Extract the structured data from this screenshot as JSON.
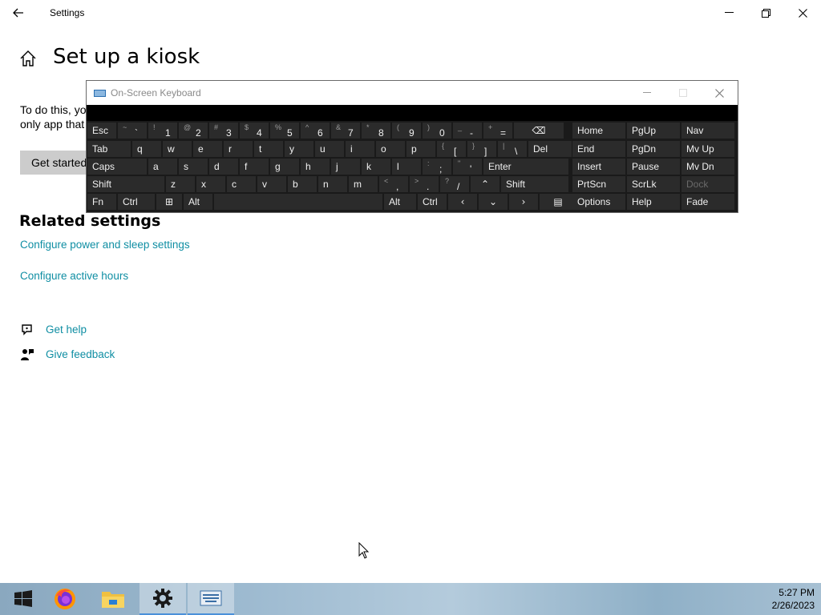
{
  "settings_window": {
    "title": "Settings",
    "back_icon": "back-arrow-icon",
    "minimize_glyph": "—",
    "restore_glyph": "❐",
    "close_glyph": "✕"
  },
  "page": {
    "title": "Set up a kiosk",
    "intro_line1": "To do this, yo",
    "intro_line2": "only app that",
    "get_started_label": "Get started"
  },
  "related": {
    "heading": "Related settings",
    "link_power": "Configure power and sleep settings",
    "link_active_hours": "Configure active hours"
  },
  "help": {
    "get_help": "Get help",
    "give_feedback": "Give feedback"
  },
  "osk": {
    "title": "On-Screen Keyboard",
    "minimize_glyph": "—",
    "maximize_glyph": "☐",
    "close_glyph": "✕",
    "rows": [
      [
        {
          "label": "Esc"
        },
        {
          "shift": "~",
          "main": "`"
        },
        {
          "shift": "!",
          "main": "1"
        },
        {
          "shift": "@",
          "main": "2"
        },
        {
          "shift": "#",
          "main": "3"
        },
        {
          "shift": "$",
          "main": "4"
        },
        {
          "shift": "%",
          "main": "5"
        },
        {
          "shift": "^",
          "main": "6"
        },
        {
          "shift": "&",
          "main": "7"
        },
        {
          "shift": "*",
          "main": "8"
        },
        {
          "shift": "(",
          "main": "9"
        },
        {
          "shift": ")",
          "main": "0"
        },
        {
          "shift": "_",
          "main": "-"
        },
        {
          "shift": "+",
          "main": "="
        },
        {
          "icon": "⌫"
        },
        {
          "label": "Home"
        },
        {
          "label": "PgUp"
        },
        {
          "label": "Nav"
        }
      ],
      [
        {
          "label": "Tab"
        },
        {
          "label": "q"
        },
        {
          "label": "w"
        },
        {
          "label": "e"
        },
        {
          "label": "r"
        },
        {
          "label": "t"
        },
        {
          "label": "y"
        },
        {
          "label": "u"
        },
        {
          "label": "i"
        },
        {
          "label": "o"
        },
        {
          "label": "p"
        },
        {
          "shift": "{",
          "main": "["
        },
        {
          "shift": "}",
          "main": "]"
        },
        {
          "shift": "|",
          "main": "\\"
        },
        {
          "label": "Del"
        },
        {
          "label": "End"
        },
        {
          "label": "PgDn"
        },
        {
          "label": "Mv Up"
        }
      ],
      [
        {
          "label": "Caps"
        },
        {
          "label": "a"
        },
        {
          "label": "s"
        },
        {
          "label": "d"
        },
        {
          "label": "f"
        },
        {
          "label": "g"
        },
        {
          "label": "h"
        },
        {
          "label": "j"
        },
        {
          "label": "k"
        },
        {
          "label": "l"
        },
        {
          "shift": ":",
          "main": ";"
        },
        {
          "shift": "\"",
          "main": "'"
        },
        {
          "label": "Enter"
        },
        {
          "label": "Insert"
        },
        {
          "label": "Pause"
        },
        {
          "label": "Mv Dn"
        }
      ],
      [
        {
          "label": "Shift"
        },
        {
          "label": "z"
        },
        {
          "label": "x"
        },
        {
          "label": "c"
        },
        {
          "label": "v"
        },
        {
          "label": "b"
        },
        {
          "label": "n"
        },
        {
          "label": "m"
        },
        {
          "shift": "<",
          "main": ","
        },
        {
          "shift": ">",
          "main": "."
        },
        {
          "shift": "?",
          "main": "/"
        },
        {
          "icon": "⌃"
        },
        {
          "label": "Shift"
        },
        {
          "label": "PrtScn"
        },
        {
          "label": "ScrLk"
        },
        {
          "label": "Dock",
          "dim": true
        }
      ],
      [
        {
          "label": "Fn"
        },
        {
          "label": "Ctrl"
        },
        {
          "icon": "⊞"
        },
        {
          "label": "Alt"
        },
        {
          "label": ""
        },
        {
          "label": "Alt"
        },
        {
          "label": "Ctrl"
        },
        {
          "icon": "‹"
        },
        {
          "icon": "⌄"
        },
        {
          "icon": "›"
        },
        {
          "icon": "▤"
        },
        {
          "label": "Options"
        },
        {
          "label": "Help"
        },
        {
          "label": "Fade"
        }
      ]
    ]
  },
  "taskbar": {
    "start_icon": "windows-start-icon",
    "items": [
      "firefox-icon",
      "file-explorer-icon",
      "settings-gear-icon",
      "on-screen-keyboard-icon"
    ],
    "time": "5:27 PM",
    "date": "2/26/2023"
  }
}
